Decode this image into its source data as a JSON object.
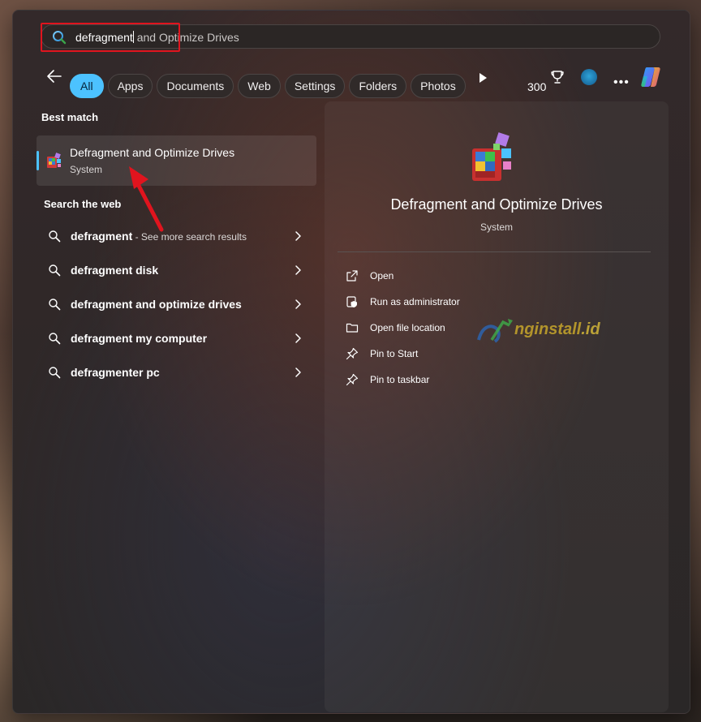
{
  "search": {
    "typed": "defragment",
    "suggestion": " and Optimize Drives"
  },
  "filters": {
    "items": [
      "All",
      "Apps",
      "Documents",
      "Web",
      "Settings",
      "Folders",
      "Photos"
    ],
    "active": "All"
  },
  "header_right": {
    "points": "300",
    "icons": [
      "play-icon",
      "trophy-icon",
      "avatar",
      "more-icon",
      "copilot-icon"
    ]
  },
  "best_match": {
    "heading": "Best match",
    "title": "Defragment and Optimize Drives",
    "subtitle": "System"
  },
  "web": {
    "heading": "Search the web",
    "items": [
      {
        "bold": "defragment",
        "rest": "",
        "hint": " - See more search results"
      },
      {
        "bold": "defragment",
        "rest": " disk",
        "hint": ""
      },
      {
        "bold": "defragment",
        "rest": " and optimize drives",
        "hint": ""
      },
      {
        "bold": "defragment",
        "rest": " my computer",
        "hint": ""
      },
      {
        "bold": "defragment",
        "rest": "er pc",
        "hint": ""
      }
    ]
  },
  "preview": {
    "title": "Defragment and Optimize Drives",
    "subtitle": "System",
    "actions": [
      {
        "label": "Open",
        "icon": "open-external-icon"
      },
      {
        "label": "Run as administrator",
        "icon": "shield-admin-icon"
      },
      {
        "label": "Open file location",
        "icon": "folder-icon"
      },
      {
        "label": "Pin to Start",
        "icon": "pin-icon"
      },
      {
        "label": "Pin to taskbar",
        "icon": "pin-icon"
      }
    ]
  },
  "watermark": {
    "text": "nginstall",
    "suffix": ".id"
  },
  "colors": {
    "accent": "#4cc2ff",
    "highlight_box": "#e0141e",
    "arrow": "#e0141e"
  }
}
